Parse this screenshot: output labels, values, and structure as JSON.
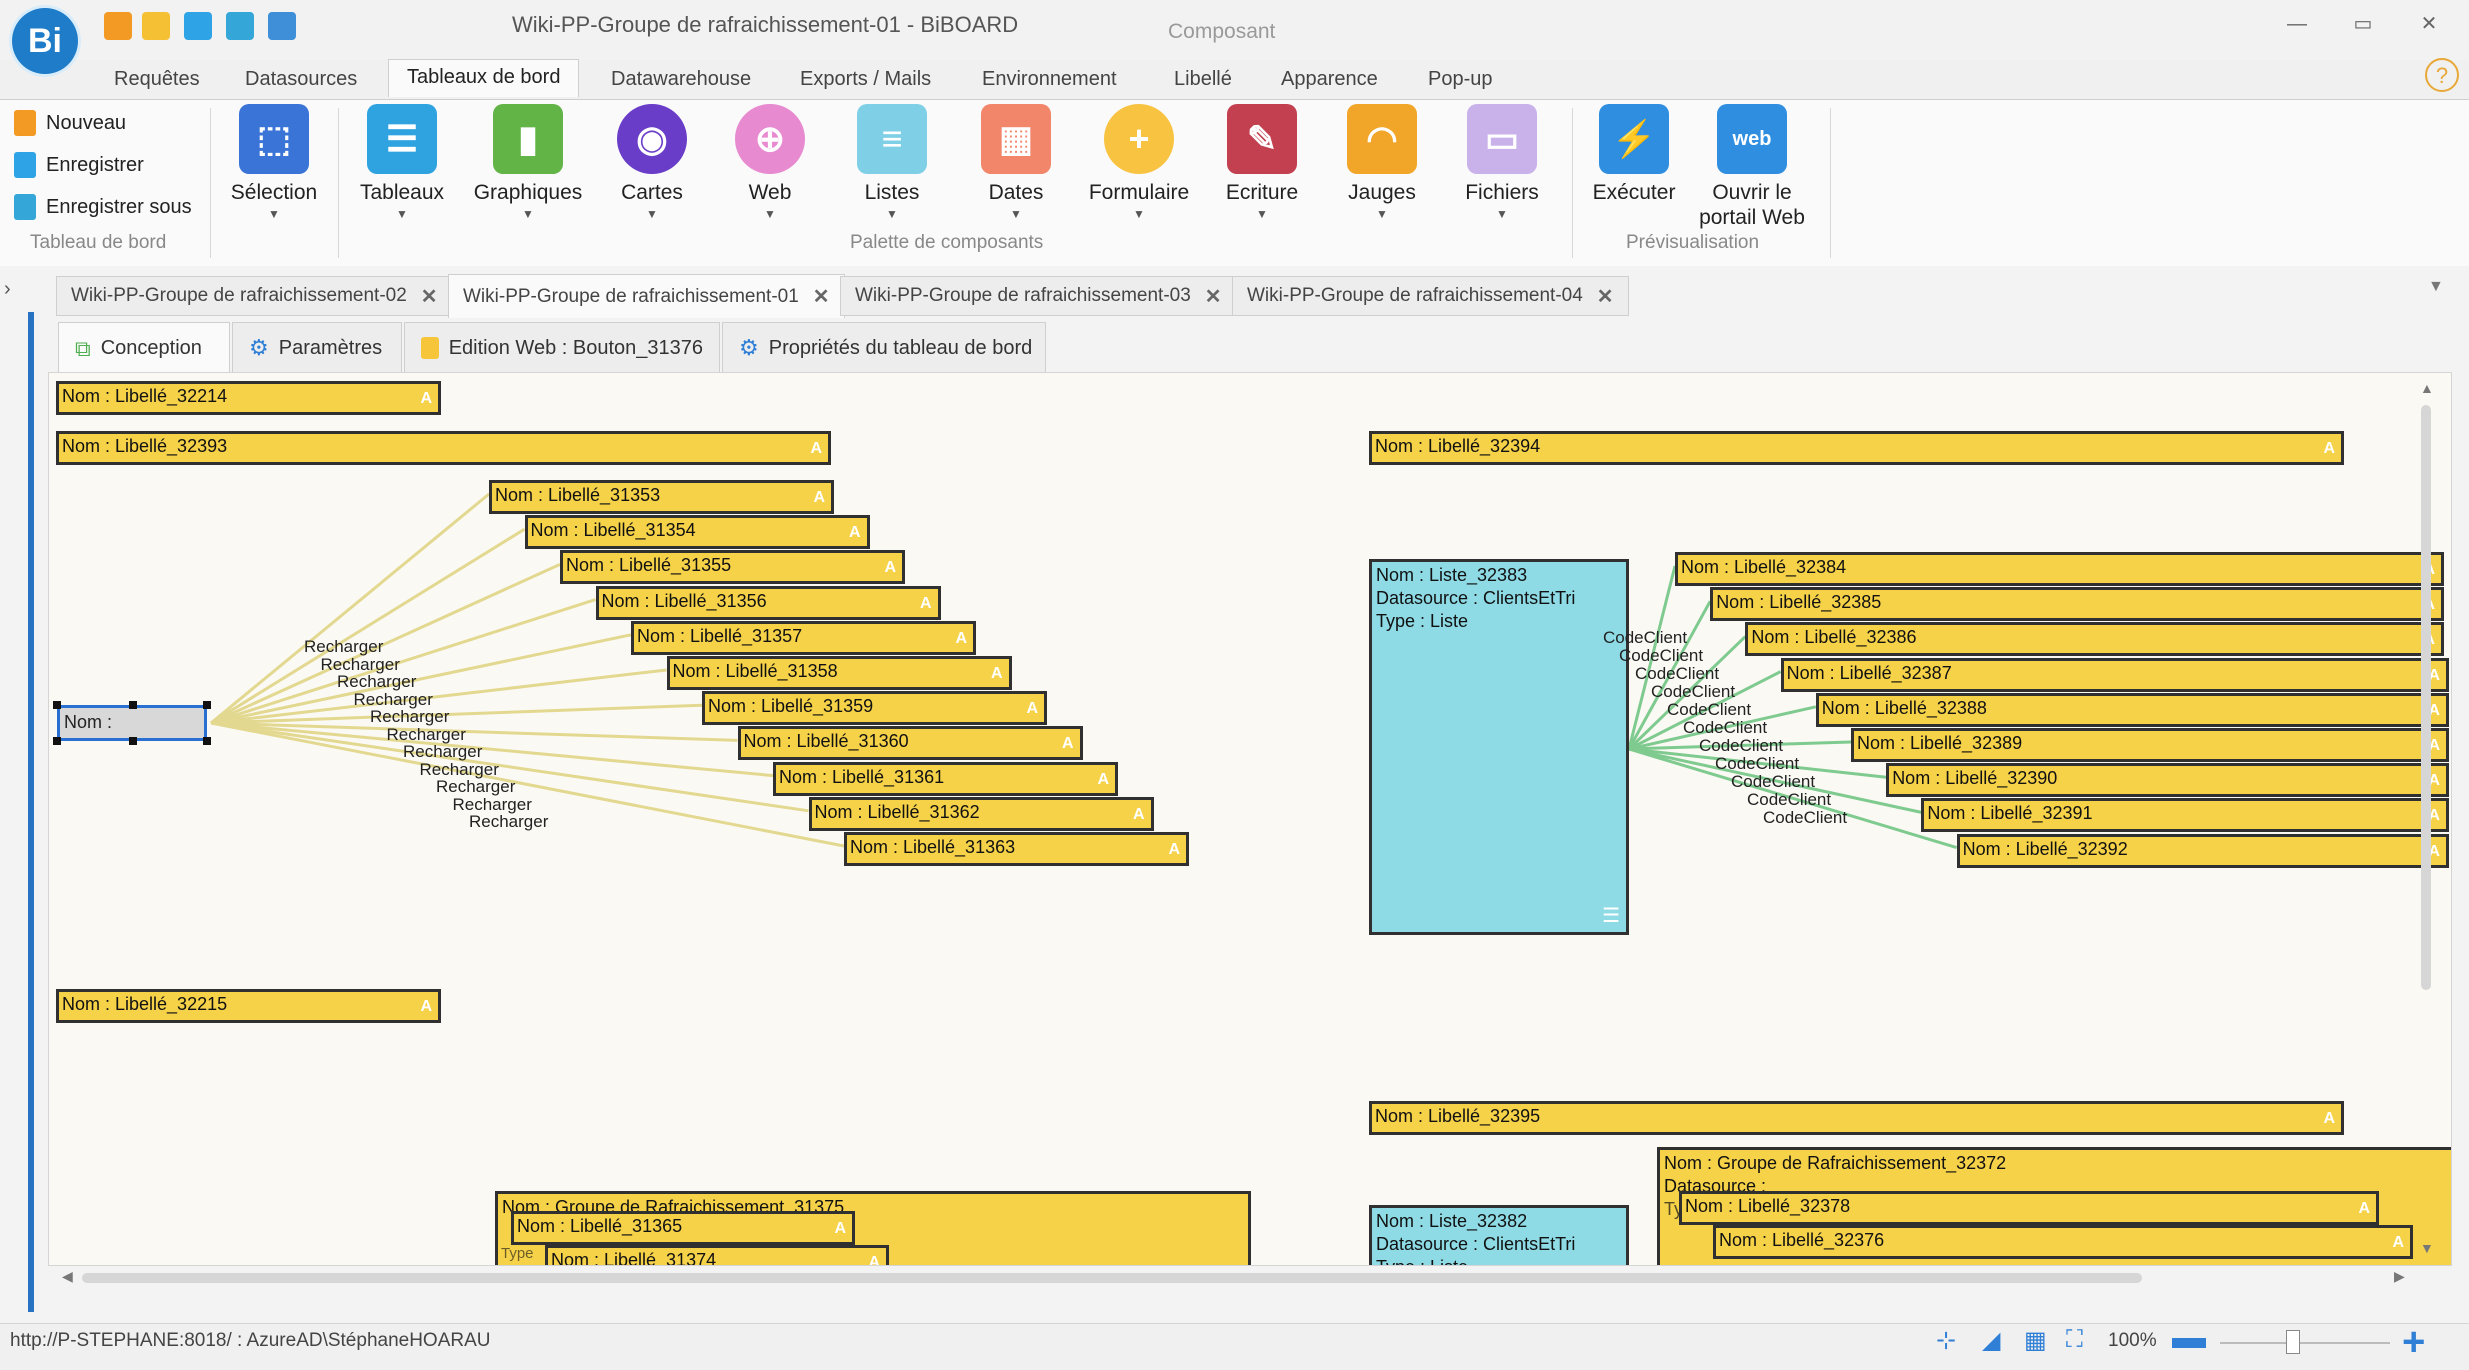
{
  "app": {
    "title": "Wiki-PP-Groupe de rafraichissement-01 - BiBOARD",
    "logo": "Bi",
    "context_label": "Composant"
  },
  "window_controls": {
    "minimize": "—",
    "restore": "▭",
    "close": "✕"
  },
  "menu": [
    "Requêtes",
    "Datasources",
    "Tableaux de bord",
    "Datawarehouse",
    "Exports / Mails",
    "Environnement",
    "Libellé",
    "Apparence",
    "Pop-up"
  ],
  "menu_active": "Tableaux de bord",
  "help_label": "?",
  "ribbon": {
    "tableau_group": {
      "label": "Tableau de bord",
      "nouveau": "Nouveau",
      "enregistrer": "Enregistrer",
      "enregistrer_sous": "Enregistrer sous"
    },
    "selection": "Sélection",
    "palette": {
      "label": "Palette de composants",
      "tableaux": "Tableaux",
      "graphiques": "Graphiques",
      "cartes": "Cartes",
      "web": "Web",
      "listes": "Listes",
      "dates": "Dates",
      "formulaire": "Formulaire",
      "ecriture": "Ecriture",
      "jauges": "Jauges",
      "fichiers": "Fichiers"
    },
    "preview": {
      "label": "Prévisualisation",
      "executer": "Exécuter",
      "portail_line1": "Ouvrir le",
      "portail_line2": "portail Web"
    }
  },
  "doc_tabs": [
    "Wiki-PP-Groupe de rafraichissement-02",
    "Wiki-PP-Groupe de rafraichissement-01",
    "Wiki-PP-Groupe de rafraichissement-03",
    "Wiki-PP-Groupe de rafraichissement-04"
  ],
  "doc_tab_close": "✕",
  "sub_tabs": [
    "Conception",
    "Paramètres",
    "Edition Web : Bouton_31376",
    "Propriétés du tableau de bord"
  ],
  "canvas": {
    "a_glyph": "A",
    "selected_label": "Nom :",
    "labels_top": {
      "l32214": "Nom : Libellé_32214",
      "l32393": "Nom : Libellé_32393",
      "l32394": "Nom : Libellé_32394",
      "l32215": "Nom : Libellé_32215",
      "l32395": "Nom : Libellé_32395"
    },
    "fan_labels": [
      "Nom : Libellé_31353",
      "Nom : Libellé_31354",
      "Nom : Libellé_31355",
      "Nom : Libellé_31356",
      "Nom : Libellé_31357",
      "Nom : Libellé_31358",
      "Nom : Libellé_31359",
      "Nom : Libellé_31360",
      "Nom : Libellé_31361",
      "Nom : Libellé_31362",
      "Nom : Libellé_31363"
    ],
    "fan_ghost": "Wiki-PP-G",
    "recharger": "Recharger",
    "list_32383": {
      "nom": "Nom : Liste_32383",
      "datasource": "Datasource : ClientsEtTri",
      "type": "Type : Liste"
    },
    "right_labels": [
      "Nom : Libellé_32384",
      "Nom : Libellé_32385",
      "Nom : Libellé_32386",
      "Nom : Libellé_32387",
      "Nom : Libellé_32388",
      "Nom : Libellé_32389",
      "Nom : Libellé_32390",
      "Nom : Libellé_32391",
      "Nom : Libellé_32392"
    ],
    "right_ghost": "ClientsEtTri",
    "codeclient": "CodeClient",
    "groupe_31375": "Nom : Groupe de Rafraichissement_31375",
    "l31365": "Nom : Libellé_31365",
    "l31374": "Nom : Libellé_31374",
    "groupe_type_ghost": "Type",
    "list_32382": {
      "nom": "Nom : Liste_32382",
      "datasource": "Datasource : ClientsEtTri",
      "type": "Type : Liste"
    },
    "groupe_32372": {
      "nom": "Nom : Groupe de Rafraichissement_32372",
      "datasource": "Datasource :",
      "type_ghost": "Ty"
    },
    "l32378": "Nom : Libellé_32378",
    "l32376": "Nom : Libellé_32376"
  },
  "status": {
    "path": "http://P-STEPHANE:8018/ : AzureAD\\StéphaneHOARAU",
    "zoom": "100%"
  },
  "colors": {
    "label_yellow": "#f6d249",
    "list_cyan": "#8edbe6",
    "edge_yellow": "#e3d88f",
    "edge_green": "#7fca8f",
    "accent_blue": "#2872c4"
  }
}
